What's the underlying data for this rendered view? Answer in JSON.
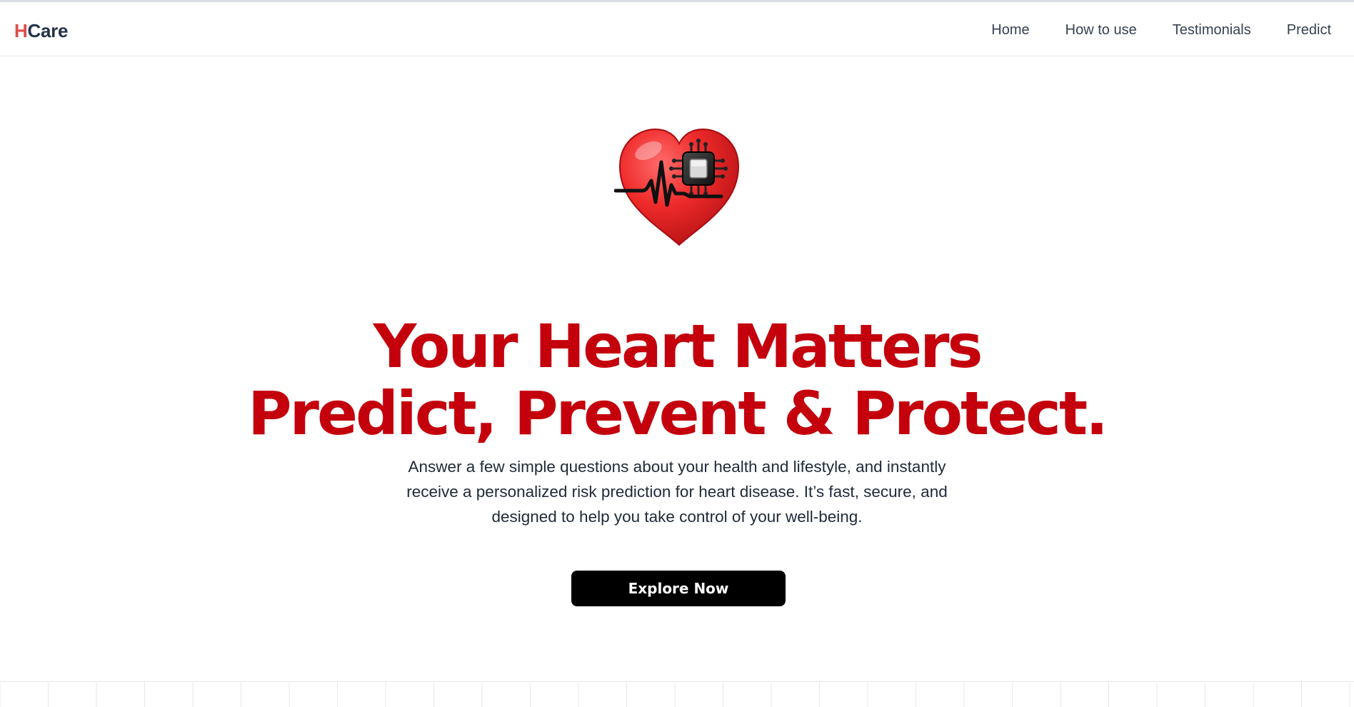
{
  "brand": {
    "initial": "H",
    "rest": "Care"
  },
  "nav": {
    "items": [
      {
        "label": "Home"
      },
      {
        "label": "How to use"
      },
      {
        "label": "Testimonials"
      },
      {
        "label": "Predict"
      }
    ]
  },
  "hero": {
    "icon": "heart-with-chip-heartbeat-icon",
    "title_line1": "Your Heart Matters",
    "title_line2": "Predict, Prevent & Protect.",
    "description": "Answer a few simple questions about your health and lifestyle, and instantly receive a personalized risk prediction for heart disease. It’s fast, secure, and designed to help you take control of your well-being.",
    "cta_label": "Explore Now"
  },
  "colors": {
    "accent_red": "#c4000c",
    "brand_h": "#e14b4b",
    "brand_text": "#24324a",
    "cta_bg": "#000000"
  }
}
